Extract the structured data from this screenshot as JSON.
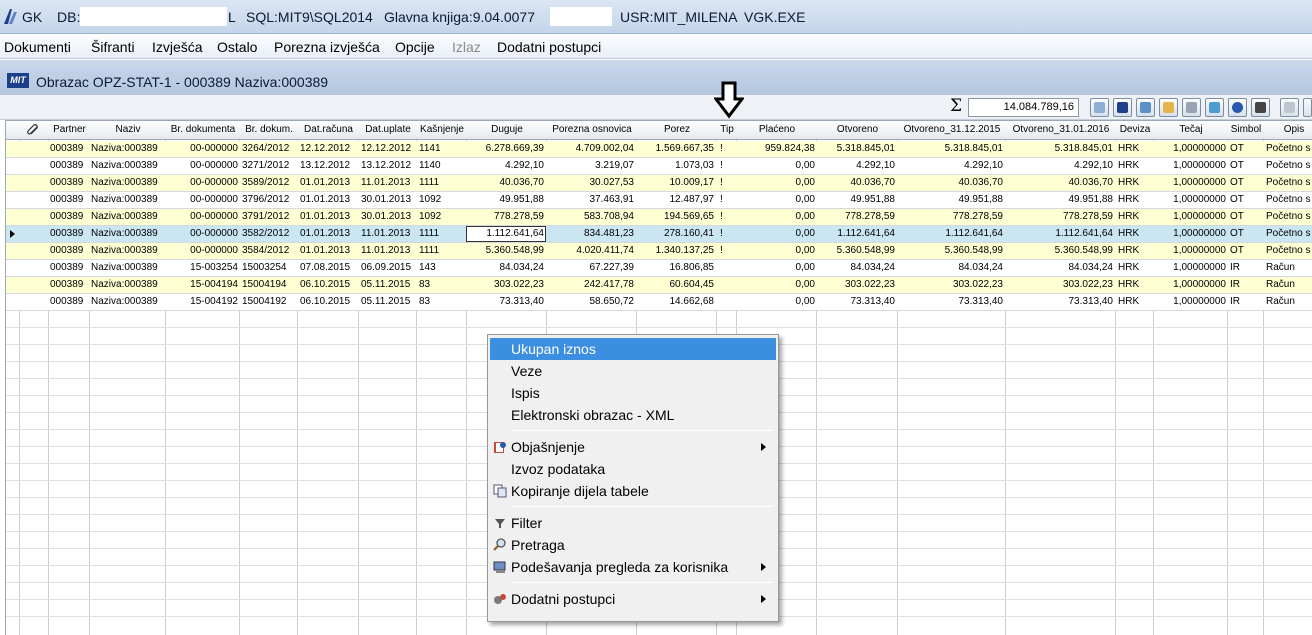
{
  "titlebar": {
    "app": "GK",
    "db_label": "DB:",
    "db_suffix": "L",
    "sql": "SQL:MIT9\\SQL2014",
    "version": "Glavna knjiga:9.04.0077",
    "user": "USR:MIT_MILENA",
    "exe": "VGK.EXE"
  },
  "menu": [
    "Dokumenti",
    "Šifranti",
    "Izvješća",
    "Ostalo",
    "Porezna izvješća",
    "Opcije",
    "Izlaz",
    "Dodatni postupci"
  ],
  "form": {
    "title": "Obrazac OPZ-STAT-1 - 000389 Naziva:000389",
    "icon_text": "MIT"
  },
  "toolbar": {
    "sigma": "Σ",
    "sum": "14.084.789,16"
  },
  "columns": [
    "Partner",
    "Naziv",
    "Br. dokumenta",
    "Br. dokum.",
    "Dat.računa",
    "Dat.uplate",
    "Kašnjenje",
    "Duguje",
    "Porezna osnovica",
    "Porez",
    "Tip",
    "Plaćeno",
    "Otvoreno",
    "Otvoreno_31.12.2015",
    "Otvoreno_31.01.2016",
    "Deviza",
    "Tečaj",
    "Simbol",
    "Opis"
  ],
  "rows": [
    [
      "000389",
      "Naziva:000389",
      "00-000000",
      "3264/2012",
      "12.12.2012",
      "12.12.2012",
      "1141",
      "6.278.669,39",
      "4.709.002,04",
      "1.569.667,35",
      "!",
      "959.824,38",
      "5.318.845,01",
      "5.318.845,01",
      "5.318.845,01",
      "HRK",
      "1,00000000",
      "OT",
      "Početno s"
    ],
    [
      "000389",
      "Naziva:000389",
      "00-000000",
      "3271/2012",
      "13.12.2012",
      "13.12.2012",
      "1140",
      "4.292,10",
      "3.219,07",
      "1.073,03",
      "!",
      "0,00",
      "4.292,10",
      "4.292,10",
      "4.292,10",
      "HRK",
      "1,00000000",
      "OT",
      "Početno s"
    ],
    [
      "000389",
      "Naziva:000389",
      "00-000000",
      "3589/2012",
      "01.01.2013",
      "11.01.2013",
      "1111",
      "40.036,70",
      "30.027,53",
      "10.009,17",
      "!",
      "0,00",
      "40.036,70",
      "40.036,70",
      "40.036,70",
      "HRK",
      "1,00000000",
      "OT",
      "Početno s"
    ],
    [
      "000389",
      "Naziva:000389",
      "00-000000",
      "3796/2012",
      "01.01.2013",
      "30.01.2013",
      "1092",
      "49.951,88",
      "37.463,91",
      "12.487,97",
      "!",
      "0,00",
      "49.951,88",
      "49.951,88",
      "49.951,88",
      "HRK",
      "1,00000000",
      "OT",
      "Početno s"
    ],
    [
      "000389",
      "Naziva:000389",
      "00-000000",
      "3791/2012",
      "01.01.2013",
      "30.01.2013",
      "1092",
      "778.278,59",
      "583.708,94",
      "194.569,65",
      "!",
      "0,00",
      "778.278,59",
      "778.278,59",
      "778.278,59",
      "HRK",
      "1,00000000",
      "OT",
      "Početno s"
    ],
    [
      "000389",
      "Naziva:000389",
      "00-000000",
      "3582/2012",
      "01.01.2013",
      "11.01.2013",
      "1111",
      "1.112.641,64",
      "834.481,23",
      "278.160,41",
      "!",
      "0,00",
      "1.112.641,64",
      "1.112.641,64",
      "1.112.641,64",
      "HRK",
      "1,00000000",
      "OT",
      "Početno s"
    ],
    [
      "000389",
      "Naziva:000389",
      "00-000000",
      "3584/2012",
      "01.01.2013",
      "11.01.2013",
      "1111",
      "5.360.548,99",
      "4.020.411,74",
      "1.340.137,25",
      "!",
      "0,00",
      "5.360.548,99",
      "5.360.548,99",
      "5.360.548,99",
      "HRK",
      "1,00000000",
      "OT",
      "Početno s"
    ],
    [
      "000389",
      "Naziva:000389",
      "15-003254",
      "15003254",
      "07.08.2015",
      "06.09.2015",
      "143",
      "84.034,24",
      "67.227,39",
      "16.806,85",
      "",
      "0,00",
      "84.034,24",
      "84.034,24",
      "84.034,24",
      "HRK",
      "1,00000000",
      "IR",
      "Račun"
    ],
    [
      "000389",
      "Naziva:000389",
      "15-004194",
      "15004194",
      "06.10.2015",
      "05.11.2015",
      "83",
      "303.022,23",
      "242.417,78",
      "60.604,45",
      "",
      "0,00",
      "303.022,23",
      "303.022,23",
      "303.022,23",
      "HRK",
      "1,00000000",
      "IR",
      "Račun"
    ],
    [
      "000389",
      "Naziva:000389",
      "15-004192",
      "15004192",
      "06.10.2015",
      "05.11.2015",
      "83",
      "73.313,40",
      "58.650,72",
      "14.662,68",
      "",
      "0,00",
      "73.313,40",
      "73.313,40",
      "73.313,40",
      "HRK",
      "1,00000000",
      "IR",
      "Račun"
    ]
  ],
  "context_menu": [
    {
      "label": "Ukupan iznos",
      "icon": "",
      "submenu": false
    },
    {
      "label": "Veze",
      "icon": "",
      "submenu": false
    },
    {
      "label": "Ispis",
      "icon": "",
      "submenu": false
    },
    {
      "label": "Elektronski obrazac - XML",
      "icon": "",
      "submenu": false
    },
    {
      "label": "Objašnjenje",
      "icon": "help-book-icon",
      "submenu": true
    },
    {
      "label": "Izvoz podataka",
      "icon": "",
      "submenu": false
    },
    {
      "label": "Kopiranje dijela tabele",
      "icon": "copy-icon",
      "submenu": false
    },
    {
      "label": "Filter",
      "icon": "filter-icon",
      "submenu": false
    },
    {
      "label": "Pretraga",
      "icon": "magnifier-icon",
      "submenu": false
    },
    {
      "label": "Podešavanja pregleda za korisnika",
      "icon": "user-settings-icon",
      "submenu": true
    },
    {
      "label": "Dodatni postupci",
      "icon": "gears-icon",
      "submenu": true
    }
  ],
  "colors": {
    "accent": "#3c8fe0",
    "yellow_row": "#ffffd4",
    "selected_row": "#cbe6f3",
    "titlebar": "#c4d5ea"
  }
}
